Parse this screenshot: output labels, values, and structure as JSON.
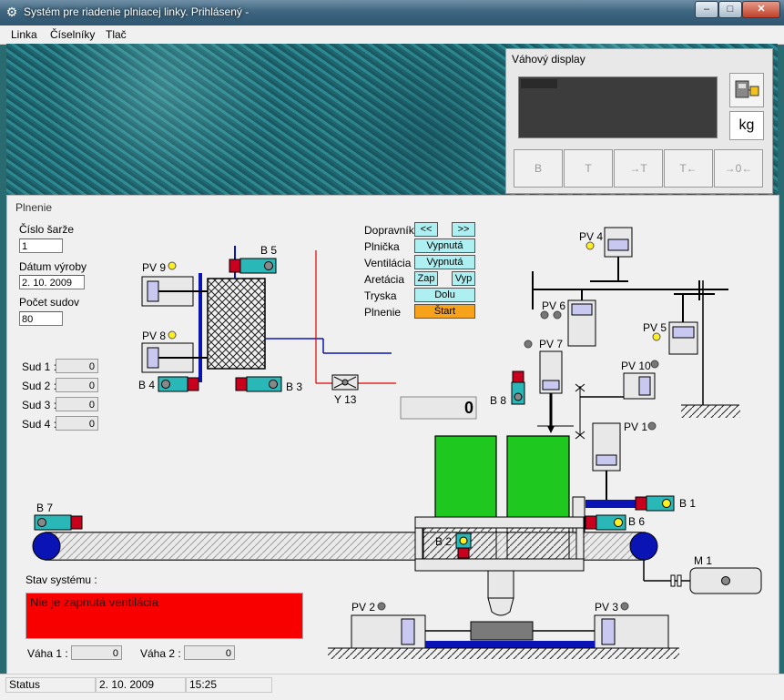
{
  "window": {
    "title": "Systém pre riadenie plniacej linky. Prihlásený -",
    "minimize": "–",
    "maximize": "□",
    "close": "✕"
  },
  "menu": [
    "Linka",
    "Číselníky",
    "Tlač"
  ],
  "weight_display": {
    "title": "Váhový display",
    "unit": "kg",
    "buttons": [
      {
        "icon": "weight-b-icon",
        "glyph": "B"
      },
      {
        "icon": "weight-t-icon",
        "glyph": "T"
      },
      {
        "icon": "tare-in-icon",
        "glyph": "→T"
      },
      {
        "icon": "tare-out-icon",
        "glyph": "T←"
      },
      {
        "icon": "zero-icon",
        "glyph": "→0←"
      }
    ]
  },
  "filling": {
    "title": "Plnenie",
    "batch_label": "Číslo šarže",
    "batch_value": "1",
    "date_label": "Dátum výroby",
    "date_value": "2. 10. 2009",
    "barrels_label": "Počet sudov",
    "barrels_value": "80",
    "barrels": [
      {
        "label": "Sud 1 :",
        "value": "0"
      },
      {
        "label": "Sud 2 :",
        "value": "0"
      },
      {
        "label": "Sud 3 :",
        "value": "0"
      },
      {
        "label": "Sud 4 :",
        "value": "0"
      }
    ],
    "controls": [
      {
        "label": "Dopravník",
        "buttons": [
          "<<",
          ">>"
        ]
      },
      {
        "label": "Plnička",
        "buttons": [
          "Vypnutá"
        ]
      },
      {
        "label": "Ventilácia",
        "buttons": [
          "Vypnutá"
        ]
      },
      {
        "label": "Aretácia",
        "buttons": [
          "Zap",
          "Vyp"
        ]
      },
      {
        "label": "Tryska",
        "buttons": [
          "Dolu"
        ]
      },
      {
        "label": "Plnenie",
        "buttons": [
          "Štart"
        ]
      }
    ],
    "counter_value": "0",
    "system_state_label": "Stav systému :",
    "system_state_message": "Nie je zapnutá ventilácia",
    "scale1_label": "Váha 1 :",
    "scale1_value": "0",
    "scale2_label": "Váha 2 :",
    "scale2_value": "0"
  },
  "components": {
    "pv9": "PV 9",
    "pv8": "PV 8",
    "b5": "B 5",
    "b4": "B 4",
    "b3": "B 3",
    "y13": "Y 13",
    "pv4": "PV 4",
    "pv6": "PV 6",
    "pv5": "PV 5",
    "pv7": "PV 7",
    "b8": "B 8",
    "pv10": "PV 10",
    "pv1": "PV 1",
    "b1": "B 1",
    "b6": "B 6",
    "b7": "B 7",
    "b2": "B 2",
    "m1": "M 1",
    "pv2": "PV 2",
    "pv3": "PV 3"
  },
  "status_bar": {
    "status": "Status",
    "date": "2. 10. 2009",
    "time": "15:25"
  },
  "colors": {
    "accent_cyan": "#aeeff1",
    "start_orange": "#f7a21b",
    "alarm_red": "#f80000",
    "barrel_green": "#1ec81e",
    "sensor_teal": "#2ab7b7",
    "sensor_red": "#c8001e",
    "indicator_yellow": "#ffee22",
    "conveyor_blue": "#0a14b4"
  }
}
